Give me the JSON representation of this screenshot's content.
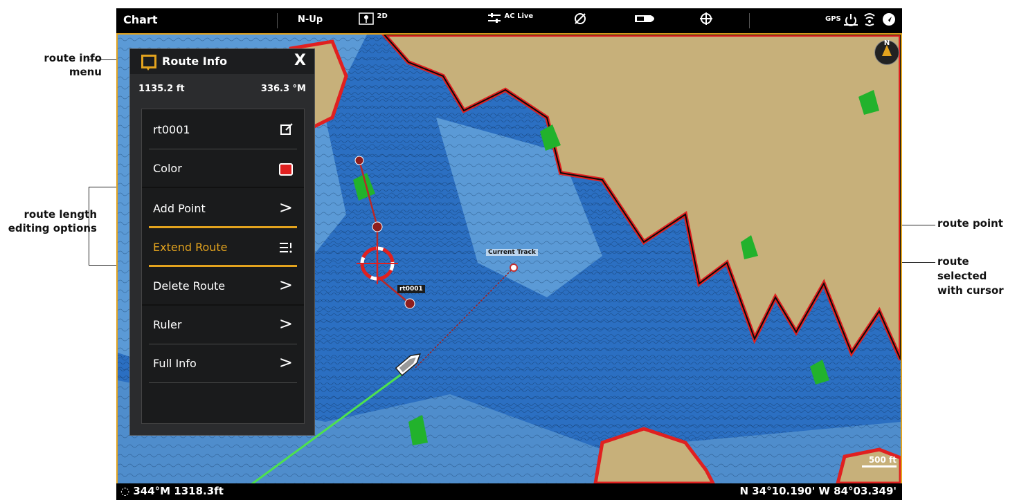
{
  "header": {
    "title": "Chart",
    "orientation": "N-Up",
    "view_mode": "2D",
    "ac_live": "AC Live",
    "gps": "GPS"
  },
  "menu": {
    "title": "Route Info",
    "close": "X",
    "distance": "1135.2 ft",
    "bearing": "336.3 °M",
    "items": [
      {
        "label": "rt0001"
      },
      {
        "label": "Color"
      },
      {
        "label": "Add Point",
        "arrow": ">"
      },
      {
        "label": "Extend Route"
      },
      {
        "label": "Delete Route",
        "arrow": ">"
      },
      {
        "label": "Ruler",
        "arrow": ">"
      },
      {
        "label": "Full Info",
        "arrow": ">"
      }
    ]
  },
  "map": {
    "route_name": "rt0001",
    "track_label": "Current Track",
    "scale": "500 ft",
    "compass": "N"
  },
  "status": {
    "heading_distance": "344°M 1318.3ft",
    "coordinates": "N 34°10.190' W 84°03.349'"
  },
  "callouts": {
    "route_info_menu": "route info menu",
    "route_length_options": "route length editing options",
    "route_point": "route point",
    "route_selected": "route selected with cursor"
  },
  "colors": {
    "accent": "#e3a31e",
    "water_deep": "#1f5fb3",
    "water_shallow": "#6ea7dc",
    "land": "#c7b07a",
    "contour_red": "#e02020",
    "route": "#c43030"
  }
}
